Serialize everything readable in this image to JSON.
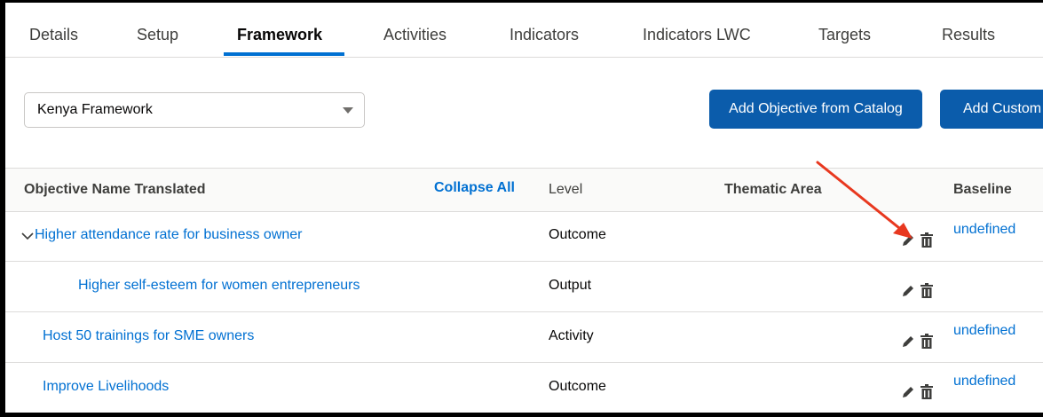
{
  "tabs": [
    {
      "label": "Details"
    },
    {
      "label": "Setup"
    },
    {
      "label": "Framework"
    },
    {
      "label": "Activities"
    },
    {
      "label": "Indicators"
    },
    {
      "label": "Indicators LWC"
    },
    {
      "label": "Targets"
    },
    {
      "label": "Results"
    }
  ],
  "active_tab": "Framework",
  "framework_select": {
    "value": "Kenya Framework"
  },
  "buttons": {
    "add_from_catalog": "Add Objective from Catalog",
    "add_custom": "Add Custom"
  },
  "table": {
    "headers": {
      "objective_name": "Objective Name Translated",
      "collapse_all": "Collapse All",
      "level": "Level",
      "thematic_area": "Thematic Area",
      "baseline": "Baseline"
    },
    "rows": [
      {
        "name": "Higher attendance rate for business owner",
        "level": "Outcome",
        "baseline": "undefined"
      },
      {
        "name": "Higher self-esteem for women entrepreneurs",
        "level": "Output",
        "baseline": ""
      },
      {
        "name": "Host 50 trainings for SME owners",
        "level": "Activity",
        "baseline": "undefined"
      },
      {
        "name": "Improve Livelihoods",
        "level": "Outcome",
        "baseline": "undefined"
      }
    ]
  },
  "colors": {
    "accent": "#0070d2",
    "button": "#0b5cab",
    "annotation_arrow": "#e8381f"
  },
  "icons": [
    "chevron-down-icon",
    "pencil-icon",
    "trash-icon",
    "caret-down-icon"
  ]
}
